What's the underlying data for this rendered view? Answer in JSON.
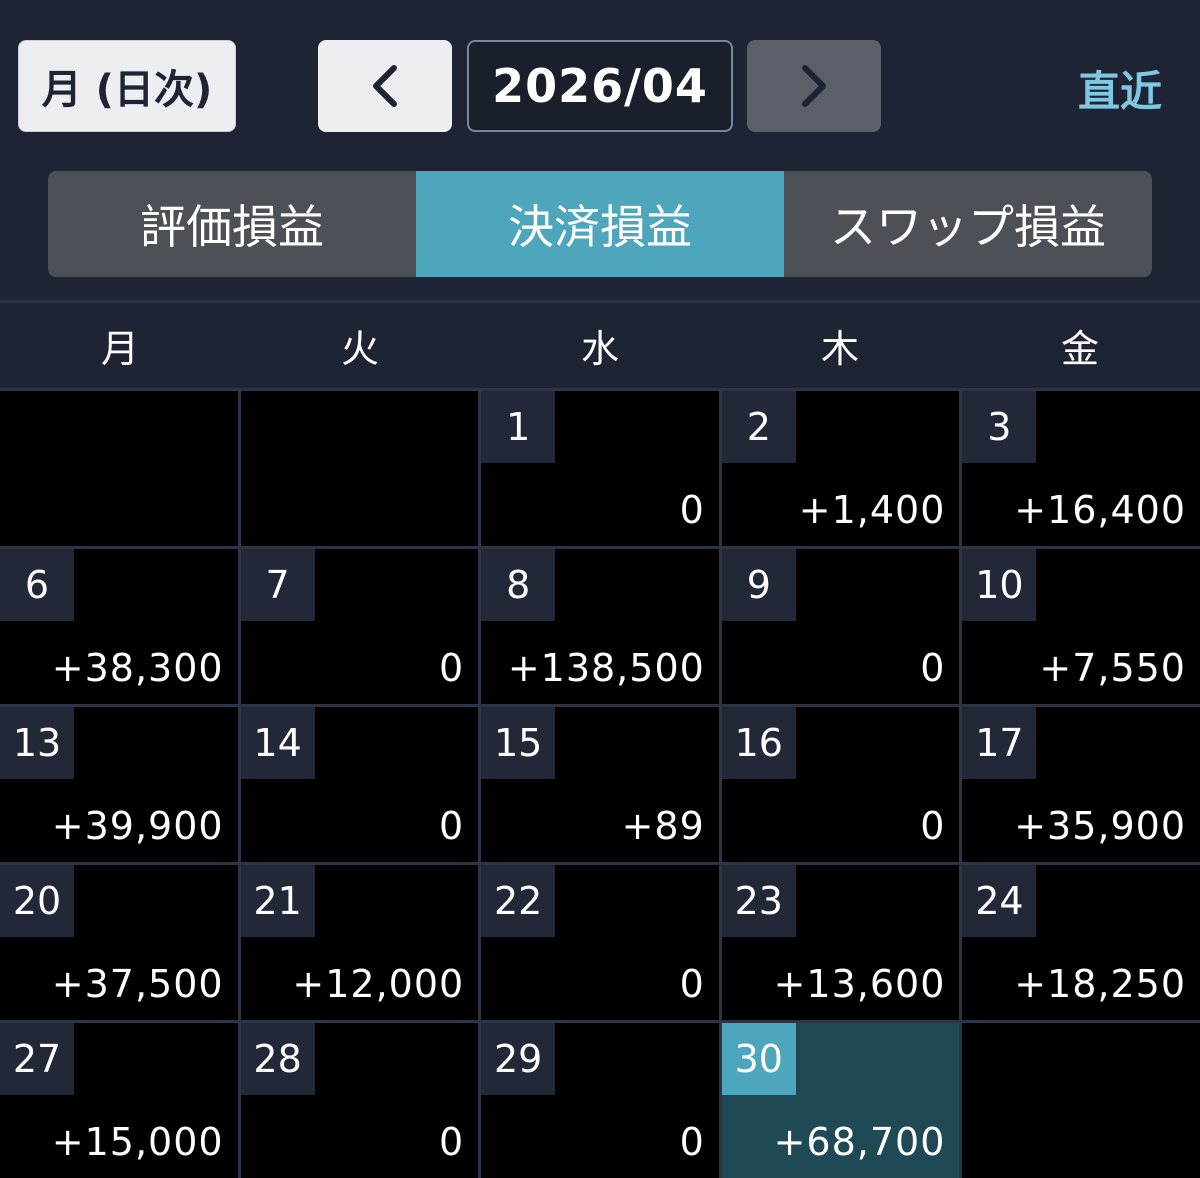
{
  "toolbar": {
    "mode_label": "月 (日次)",
    "month": "2026/04",
    "recent_label": "直近",
    "prev_icon": "chevron-left-icon",
    "next_icon": "chevron-right-icon"
  },
  "tabs": [
    {
      "label": "評価損益",
      "active": false
    },
    {
      "label": "決済損益",
      "active": true
    },
    {
      "label": "スワップ損益",
      "active": false
    }
  ],
  "weekdays": [
    "月",
    "火",
    "水",
    "木",
    "金"
  ],
  "calendar": [
    {
      "day": "",
      "value": ""
    },
    {
      "day": "",
      "value": ""
    },
    {
      "day": "1",
      "value": "0"
    },
    {
      "day": "2",
      "value": "+1,400"
    },
    {
      "day": "3",
      "value": "+16,400"
    },
    {
      "day": "6",
      "value": "+38,300"
    },
    {
      "day": "7",
      "value": "0"
    },
    {
      "day": "8",
      "value": "+138,500"
    },
    {
      "day": "9",
      "value": "0"
    },
    {
      "day": "10",
      "value": "+7,550"
    },
    {
      "day": "13",
      "value": "+39,900"
    },
    {
      "day": "14",
      "value": "0"
    },
    {
      "day": "15",
      "value": "+89"
    },
    {
      "day": "16",
      "value": "0"
    },
    {
      "day": "17",
      "value": "+35,900"
    },
    {
      "day": "20",
      "value": "+37,500"
    },
    {
      "day": "21",
      "value": "+12,000"
    },
    {
      "day": "22",
      "value": "0"
    },
    {
      "day": "23",
      "value": "+13,600"
    },
    {
      "day": "24",
      "value": "+18,250"
    },
    {
      "day": "27",
      "value": "+15,000"
    },
    {
      "day": "28",
      "value": "0"
    },
    {
      "day": "29",
      "value": "0"
    },
    {
      "day": "30",
      "value": "+68,700",
      "today": true
    },
    {
      "day": "",
      "value": ""
    }
  ],
  "colors": {
    "accent": "#4ea6bc",
    "recent_link": "#7ec8e3",
    "background": "#1e2433",
    "today_cell": "#1f4a55"
  }
}
